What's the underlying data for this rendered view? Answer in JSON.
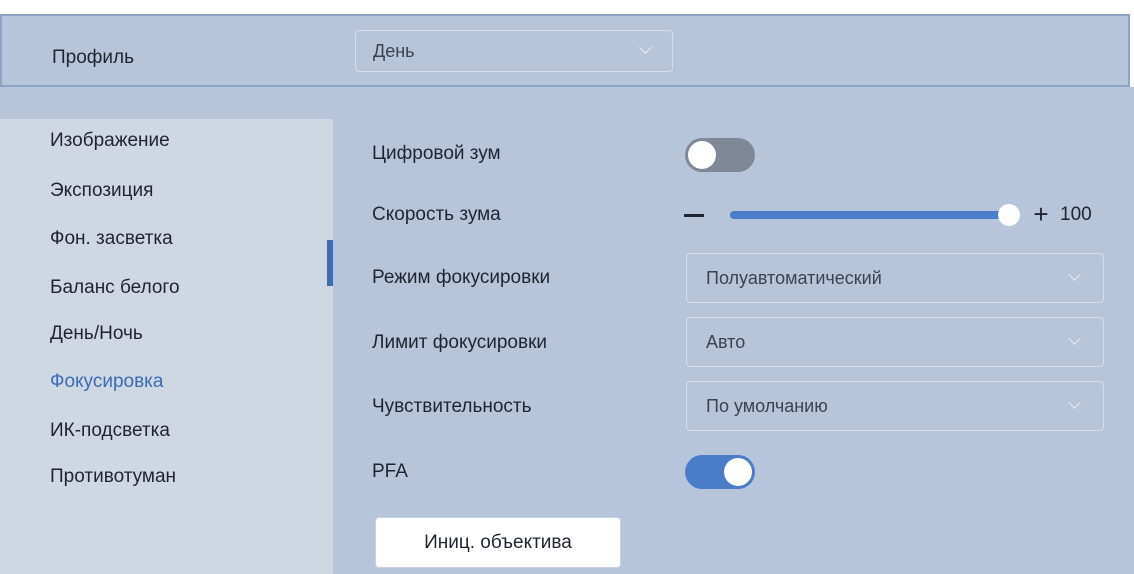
{
  "header": {
    "profile_label": "Профиль",
    "profile_value": "День"
  },
  "sidebar": {
    "active_index": 5,
    "items": [
      {
        "label": "Изображение"
      },
      {
        "label": "Экспозиция"
      },
      {
        "label": "Фон. засветка"
      },
      {
        "label": "Баланс белого"
      },
      {
        "label": "День/Ночь"
      },
      {
        "label": "Фокусировка"
      },
      {
        "label": "ИК-подсветка"
      },
      {
        "label": "Противотуман"
      }
    ]
  },
  "settings": {
    "digital_zoom": {
      "label": "Цифровой зум",
      "enabled": false
    },
    "zoom_speed": {
      "label": "Скорость зума",
      "value": "100",
      "minus_icon": "minus-icon",
      "plus_icon": "plus-icon"
    },
    "focus_mode": {
      "label": "Режим фокусировки",
      "value": "Полуавтоматический"
    },
    "focus_limit": {
      "label": "Лимит фокусировки",
      "value": "Авто"
    },
    "sensitivity": {
      "label": "Чувствительность",
      "value": "По умолчанию"
    },
    "pfa": {
      "label": "PFA",
      "enabled": true
    },
    "lens_init_label": "Иниц. объектива"
  },
  "colors": {
    "accent": "#4a7cc7",
    "panel": "#b7c5db",
    "sidebar": "#cfd7e2"
  }
}
